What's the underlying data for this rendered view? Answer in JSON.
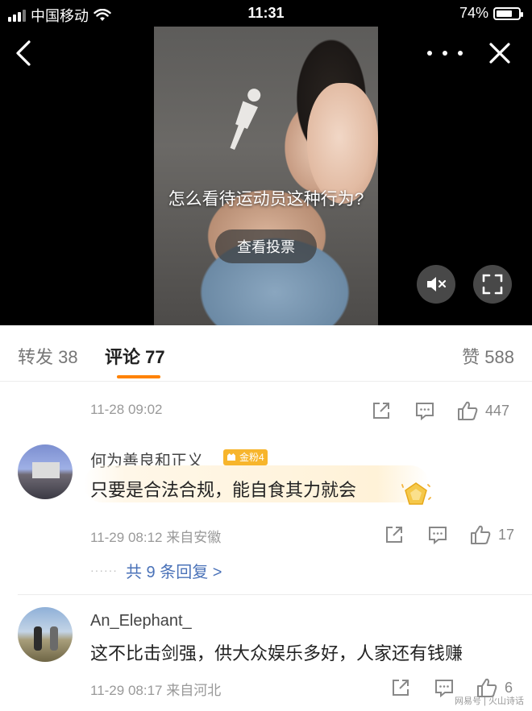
{
  "status_bar": {
    "carrier": "中国移动",
    "time": "11:31",
    "battery": "74%",
    "battery_level": 0.74
  },
  "nav": {
    "back_icon": "chevron-left-icon",
    "more_icon": "more-horizontal-icon",
    "close_icon": "close-icon"
  },
  "video": {
    "caption": "怎么看待运动员这种行为?",
    "vote_button": "查看投票",
    "mute_icon": "mute-icon",
    "fullscreen_icon": "fullscreen-icon"
  },
  "tabs": {
    "repost": "转发 38",
    "comment": "评论 77",
    "like": "赞 588",
    "active_color": "#ff8200"
  },
  "post_meta": {
    "date": "11-28 09:02",
    "like_count": "447"
  },
  "comments": [
    {
      "user": "何为善良和正义",
      "badge": "金粉4",
      "text": "只要是合法合规，能自食其力就会",
      "meta": "11-29 08:12 来自安徽",
      "like_count": "17",
      "replies": "共 9 条回复 >"
    },
    {
      "user": "An_Elephant_",
      "text": "这不比击剑强，供大众娱乐多好，人家还有钱赚",
      "meta": "11-29 08:17 来自河北",
      "like_count": "6"
    }
  ],
  "watermark": "网易号 | 火山诗话",
  "colors": {
    "link": "#4a72b8",
    "badge": "#f7b52c"
  }
}
